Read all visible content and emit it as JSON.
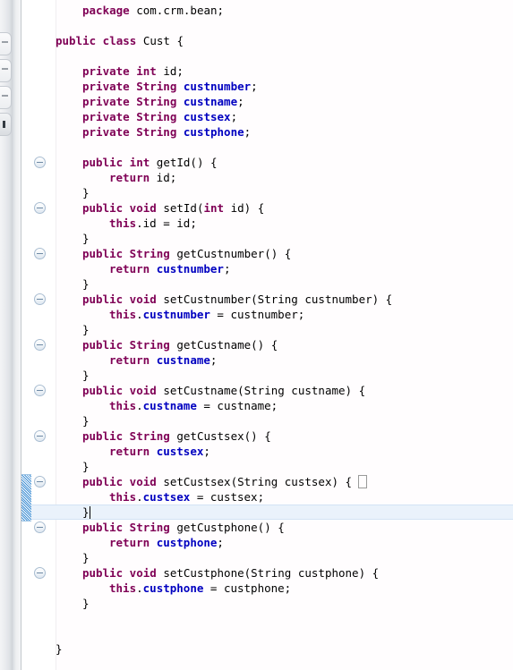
{
  "app": {
    "kind": "java-source-editor",
    "file_class": "Cust",
    "package": "com.crm.bean"
  },
  "colors": {
    "keyword": "#7f0055",
    "field": "#0000c0",
    "plain": "#000000",
    "background": "#ffffff",
    "current_line_highlight": "#eaf2fb",
    "current_line_border": "#d3e3f4",
    "change_marker": "#3f8fd4",
    "fold_marker_border": "#a9bdd1",
    "palette_background": "#e9ebee"
  },
  "gutter": {
    "fold_marker_icon": "collapse-minus-icon",
    "fold_marker_rows": [
      10,
      13,
      16,
      19,
      22,
      25,
      28,
      31,
      34,
      37
    ],
    "change_marker_start_row": 31,
    "change_marker_end_row": 33
  },
  "palette": {
    "buttons": [
      "palette-toggle-1",
      "palette-toggle-2",
      "palette-toggle-3",
      "palette-toggle-4"
    ]
  },
  "editor": {
    "current_line_row": 33,
    "caret_row": 33,
    "caret_col": 6,
    "bracket_match_row": 31,
    "bracket_match_col": 42,
    "line_height": 17,
    "char_width": 7.51,
    "lines": [
      {
        "row": 0,
        "indent": 1,
        "tokens": [
          {
            "t": "kw",
            "v": "package"
          },
          {
            "t": "plain",
            "v": " com.crm.bean;"
          }
        ]
      },
      {
        "row": 1,
        "indent": 0,
        "tokens": []
      },
      {
        "row": 2,
        "indent": 0,
        "tokens": [
          {
            "t": "kw",
            "v": "public class"
          },
          {
            "t": "plain",
            "v": " Cust {"
          }
        ]
      },
      {
        "row": 3,
        "indent": 0,
        "tokens": []
      },
      {
        "row": 4,
        "indent": 1,
        "tokens": [
          {
            "t": "kw",
            "v": "private int"
          },
          {
            "t": "plain",
            "v": " id;"
          }
        ]
      },
      {
        "row": 5,
        "indent": 1,
        "tokens": [
          {
            "t": "kw",
            "v": "private String"
          },
          {
            "t": "plain",
            "v": " "
          },
          {
            "t": "fld",
            "v": "custnumber"
          },
          {
            "t": "plain",
            "v": ";"
          }
        ]
      },
      {
        "row": 6,
        "indent": 1,
        "tokens": [
          {
            "t": "kw",
            "v": "private String"
          },
          {
            "t": "plain",
            "v": " "
          },
          {
            "t": "fld",
            "v": "custname"
          },
          {
            "t": "plain",
            "v": ";"
          }
        ]
      },
      {
        "row": 7,
        "indent": 1,
        "tokens": [
          {
            "t": "kw",
            "v": "private String"
          },
          {
            "t": "plain",
            "v": " "
          },
          {
            "t": "fld",
            "v": "custsex"
          },
          {
            "t": "plain",
            "v": ";"
          }
        ]
      },
      {
        "row": 8,
        "indent": 1,
        "tokens": [
          {
            "t": "kw",
            "v": "private String"
          },
          {
            "t": "plain",
            "v": " "
          },
          {
            "t": "fld",
            "v": "custphone"
          },
          {
            "t": "plain",
            "v": ";"
          }
        ]
      },
      {
        "row": 9,
        "indent": 0,
        "tokens": []
      },
      {
        "row": 10,
        "indent": 1,
        "tokens": [
          {
            "t": "kw",
            "v": "public int"
          },
          {
            "t": "plain",
            "v": " getId() {"
          }
        ]
      },
      {
        "row": 11,
        "indent": 2,
        "tokens": [
          {
            "t": "kw",
            "v": "return"
          },
          {
            "t": "plain",
            "v": " id;"
          }
        ]
      },
      {
        "row": 12,
        "indent": 1,
        "tokens": [
          {
            "t": "plain",
            "v": "}"
          }
        ]
      },
      {
        "row": 13,
        "indent": 1,
        "tokens": [
          {
            "t": "kw",
            "v": "public void"
          },
          {
            "t": "plain",
            "v": " setId("
          },
          {
            "t": "kw",
            "v": "int"
          },
          {
            "t": "plain",
            "v": " id) {"
          }
        ]
      },
      {
        "row": 14,
        "indent": 2,
        "tokens": [
          {
            "t": "kw",
            "v": "this"
          },
          {
            "t": "plain",
            "v": ".id = id;"
          }
        ]
      },
      {
        "row": 15,
        "indent": 1,
        "tokens": [
          {
            "t": "plain",
            "v": "}"
          }
        ]
      },
      {
        "row": 16,
        "indent": 1,
        "tokens": [
          {
            "t": "kw",
            "v": "public String"
          },
          {
            "t": "plain",
            "v": " getCustnumber() {"
          }
        ]
      },
      {
        "row": 17,
        "indent": 2,
        "tokens": [
          {
            "t": "kw",
            "v": "return"
          },
          {
            "t": "plain",
            "v": " "
          },
          {
            "t": "fld",
            "v": "custnumber"
          },
          {
            "t": "plain",
            "v": ";"
          }
        ]
      },
      {
        "row": 18,
        "indent": 1,
        "tokens": [
          {
            "t": "plain",
            "v": "}"
          }
        ]
      },
      {
        "row": 19,
        "indent": 1,
        "tokens": [
          {
            "t": "kw",
            "v": "public void"
          },
          {
            "t": "plain",
            "v": " setCustnumber(String custnumber) {"
          }
        ]
      },
      {
        "row": 20,
        "indent": 2,
        "tokens": [
          {
            "t": "kw",
            "v": "this"
          },
          {
            "t": "plain",
            "v": "."
          },
          {
            "t": "fld",
            "v": "custnumber"
          },
          {
            "t": "plain",
            "v": " = custnumber;"
          }
        ]
      },
      {
        "row": 21,
        "indent": 1,
        "tokens": [
          {
            "t": "plain",
            "v": "}"
          }
        ]
      },
      {
        "row": 22,
        "indent": 1,
        "tokens": [
          {
            "t": "kw",
            "v": "public String"
          },
          {
            "t": "plain",
            "v": " getCustname() {"
          }
        ]
      },
      {
        "row": 23,
        "indent": 2,
        "tokens": [
          {
            "t": "kw",
            "v": "return"
          },
          {
            "t": "plain",
            "v": " "
          },
          {
            "t": "fld",
            "v": "custname"
          },
          {
            "t": "plain",
            "v": ";"
          }
        ]
      },
      {
        "row": 24,
        "indent": 1,
        "tokens": [
          {
            "t": "plain",
            "v": "}"
          }
        ]
      },
      {
        "row": 25,
        "indent": 1,
        "tokens": [
          {
            "t": "kw",
            "v": "public void"
          },
          {
            "t": "plain",
            "v": " setCustname(String custname) {"
          }
        ]
      },
      {
        "row": 26,
        "indent": 2,
        "tokens": [
          {
            "t": "kw",
            "v": "this"
          },
          {
            "t": "plain",
            "v": "."
          },
          {
            "t": "fld",
            "v": "custname"
          },
          {
            "t": "plain",
            "v": " = custname;"
          }
        ]
      },
      {
        "row": 27,
        "indent": 1,
        "tokens": [
          {
            "t": "plain",
            "v": "}"
          }
        ]
      },
      {
        "row": 28,
        "indent": 1,
        "tokens": [
          {
            "t": "kw",
            "v": "public String"
          },
          {
            "t": "plain",
            "v": " getCustsex() {"
          }
        ]
      },
      {
        "row": 29,
        "indent": 2,
        "tokens": [
          {
            "t": "kw",
            "v": "return"
          },
          {
            "t": "plain",
            "v": " "
          },
          {
            "t": "fld",
            "v": "custsex"
          },
          {
            "t": "plain",
            "v": ";"
          }
        ]
      },
      {
        "row": 30,
        "indent": 1,
        "tokens": [
          {
            "t": "plain",
            "v": "}"
          }
        ]
      },
      {
        "row": 31,
        "indent": 1,
        "tokens": [
          {
            "t": "kw",
            "v": "public void"
          },
          {
            "t": "plain",
            "v": " setCustsex(String custsex) {"
          }
        ]
      },
      {
        "row": 32,
        "indent": 2,
        "tokens": [
          {
            "t": "kw",
            "v": "this"
          },
          {
            "t": "plain",
            "v": "."
          },
          {
            "t": "fld",
            "v": "custsex"
          },
          {
            "t": "plain",
            "v": " = custsex;"
          }
        ]
      },
      {
        "row": 33,
        "indent": 1,
        "tokens": [
          {
            "t": "plain",
            "v": "}"
          }
        ]
      },
      {
        "row": 34,
        "indent": 1,
        "tokens": [
          {
            "t": "kw",
            "v": "public String"
          },
          {
            "t": "plain",
            "v": " getCustphone() {"
          }
        ]
      },
      {
        "row": 35,
        "indent": 2,
        "tokens": [
          {
            "t": "kw",
            "v": "return"
          },
          {
            "t": "plain",
            "v": " "
          },
          {
            "t": "fld",
            "v": "custphone"
          },
          {
            "t": "plain",
            "v": ";"
          }
        ]
      },
      {
        "row": 36,
        "indent": 1,
        "tokens": [
          {
            "t": "plain",
            "v": "}"
          }
        ]
      },
      {
        "row": 37,
        "indent": 1,
        "tokens": [
          {
            "t": "kw",
            "v": "public void"
          },
          {
            "t": "plain",
            "v": " setCustphone(String custphone) {"
          }
        ]
      },
      {
        "row": 38,
        "indent": 2,
        "tokens": [
          {
            "t": "kw",
            "v": "this"
          },
          {
            "t": "plain",
            "v": "."
          },
          {
            "t": "fld",
            "v": "custphone"
          },
          {
            "t": "plain",
            "v": " = custphone;"
          }
        ]
      },
      {
        "row": 39,
        "indent": 1,
        "tokens": [
          {
            "t": "plain",
            "v": "}"
          }
        ]
      },
      {
        "row": 40,
        "indent": 0,
        "tokens": []
      },
      {
        "row": 41,
        "indent": 0,
        "tokens": []
      },
      {
        "row": 42,
        "indent": 0,
        "tokens": [
          {
            "t": "plain",
            "v": "}"
          }
        ]
      }
    ]
  }
}
